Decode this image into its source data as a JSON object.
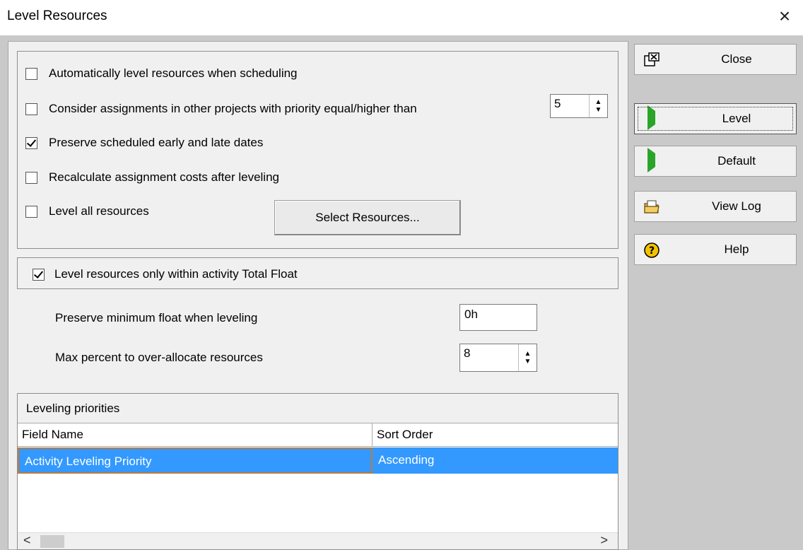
{
  "window": {
    "title": "Level Resources",
    "close_glyph": "×"
  },
  "options": {
    "auto_level": {
      "label": "Automatically level resources when scheduling",
      "checked": false
    },
    "consider_other": {
      "label": "Consider assignments in other projects with priority equal/higher than",
      "checked": false,
      "value": "5"
    },
    "preserve_dates": {
      "label": "Preserve scheduled early and late dates",
      "checked": true
    },
    "recalc_costs": {
      "label": "Recalculate assignment costs after leveling",
      "checked": false
    },
    "level_all": {
      "label": "Level all resources",
      "checked": false
    },
    "select_resources_label": "Select Resources..."
  },
  "total_float": {
    "label": "Level resources only within activity Total Float",
    "checked": true,
    "min_float_label": "Preserve minimum float when leveling",
    "min_float_value": "0h",
    "max_percent_label": "Max percent to over-allocate resources",
    "max_percent_value": "8"
  },
  "priorities": {
    "caption": "Leveling priorities",
    "columns": [
      "Field Name",
      "Sort Order"
    ],
    "rows": [
      {
        "field": "Activity Leveling Priority",
        "order": "Ascending"
      }
    ]
  },
  "actions": {
    "close": "Close",
    "level": "Level",
    "default": "Default",
    "view_log": "View Log",
    "help": "Help"
  },
  "colors": {
    "selection": "#3399ff",
    "play_green": "#2aa52a",
    "help_yellow": "#f2c200"
  }
}
